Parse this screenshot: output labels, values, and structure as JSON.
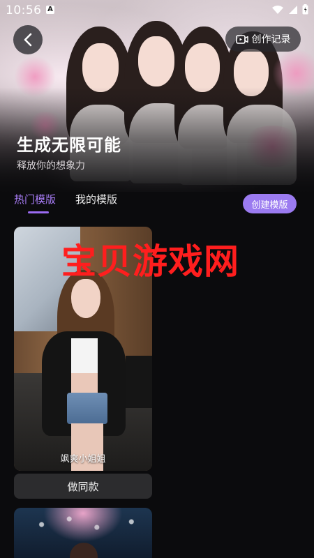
{
  "status_bar": {
    "time": "10:56",
    "notification_letter": "A"
  },
  "header": {
    "record_label": "创作记录",
    "title": "生成无限可能",
    "subtitle": "释放你的想象力"
  },
  "tabs": [
    {
      "label": "热门模版",
      "active": true
    },
    {
      "label": "我的模版",
      "active": false
    }
  ],
  "create_template_label": "创建模版",
  "templates": [
    {
      "name": "飒爽小姐姐",
      "cta": "做同款"
    }
  ],
  "watermark": "宝贝游戏网",
  "colors": {
    "accent": "#9b6bf2",
    "accent_button": "#9b7bf0",
    "background": "#0b0b0d",
    "watermark": "#ff1e1e"
  }
}
